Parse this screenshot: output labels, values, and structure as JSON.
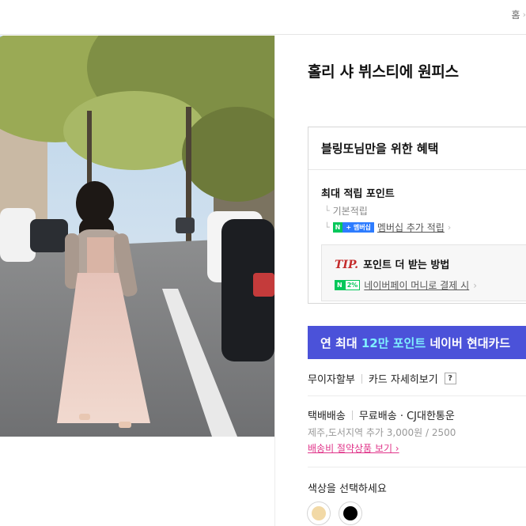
{
  "breadcrumb": {
    "home": "홈",
    "chevron": "›"
  },
  "product": {
    "image_alt": "woman in pink tulle dress on tree-lined street",
    "title": "홀리 샤 뷔스티에 원피스"
  },
  "benefit": {
    "header": "블링또님만을 위한 혜택",
    "points_title": "최대 적립 포인트",
    "basic": "기본적립",
    "membership_badge": "멤버십",
    "membership_link": "멤버십 추가 적립",
    "tip_word": "TIP.",
    "tip_text": "포인트 더 받는 방법",
    "pay_badge_pct": "2%",
    "pay_link": "네이버페이 머니로 결제 시"
  },
  "banner": {
    "pre": "연 최대 ",
    "highlight": "12만 포인트",
    "post": " 네이버 현대카드"
  },
  "installment": {
    "label": "무이자할부",
    "card_link": "카드 자세히보기",
    "help": "?"
  },
  "shipping": {
    "method": "택배배송",
    "fee": "무료배송 · CJ대한통운",
    "extra": "제주,도서지역 추가 3,000원 / 2500",
    "saver_link": "배송비 절약상품 보기 ›"
  },
  "options": {
    "color_label": "색상을 선택하세요",
    "swatches": [
      {
        "name": "beige",
        "hex": "#f2d9a6"
      },
      {
        "name": "black",
        "hex": "#000000"
      }
    ]
  },
  "colors": {
    "accent_banner": "#4b52d9",
    "highlight": "#7ff0ff",
    "tip_red": "#c42b2b",
    "link_pink": "#e0358a",
    "naver_green": "#03c75a"
  }
}
